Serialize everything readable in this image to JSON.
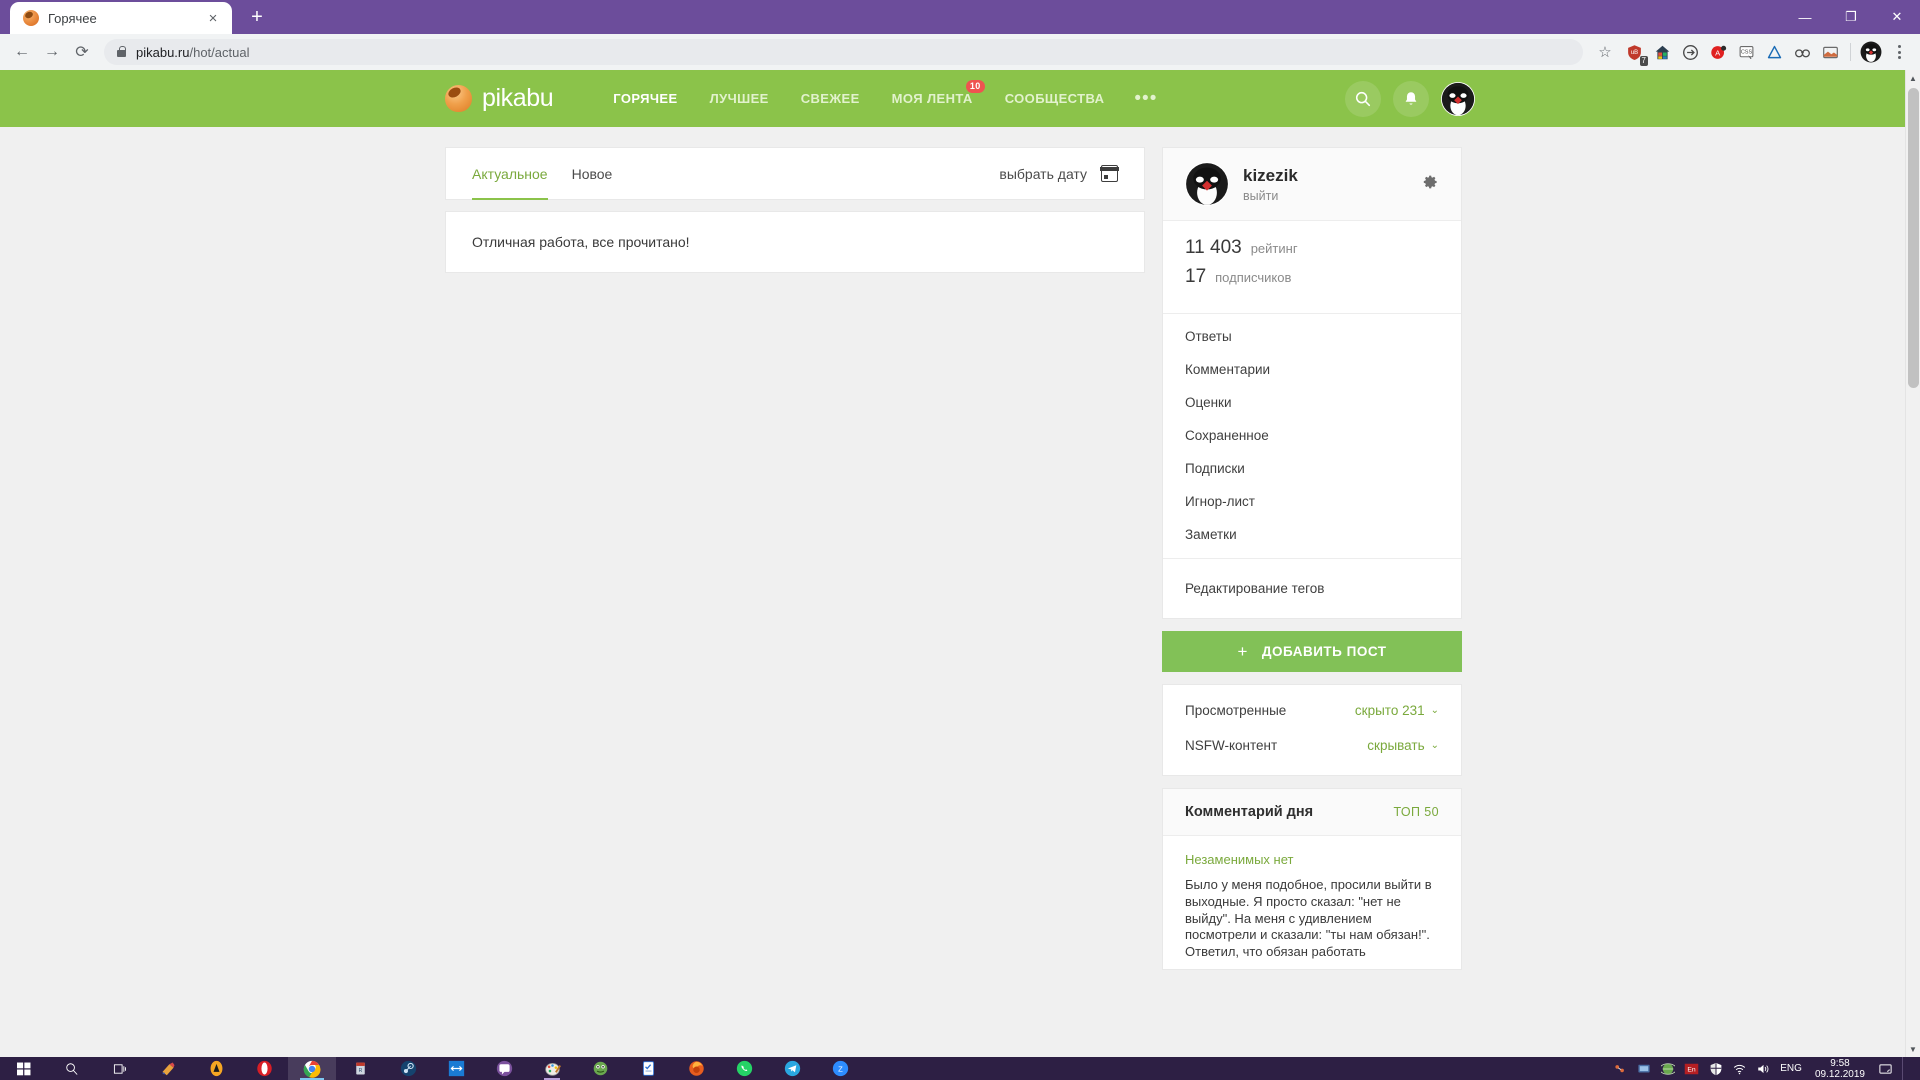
{
  "browser": {
    "tab": {
      "title": "Горячее",
      "favicon": "pikabu-favicon",
      "close": "×"
    },
    "new_tab": "+",
    "window_controls": {
      "minimize": "—",
      "maximize": "❐",
      "close": "✕"
    },
    "nav": {
      "back": "←",
      "forward": "→",
      "reload": "⟳"
    },
    "address": {
      "domain": "pikabu.ru",
      "path": "/hot/actual",
      "lock": "secure-lock"
    },
    "bookmark_star": "☆",
    "extensions": [
      {
        "name": "ublock-origin-icon",
        "badge": "7"
      },
      {
        "name": "colorful-house-icon",
        "badge": ""
      },
      {
        "name": "circle-arrow-icon",
        "badge": ""
      },
      {
        "name": "adblock-icon",
        "badge": ""
      },
      {
        "name": "css-viewer-icon",
        "badge": ""
      },
      {
        "name": "triangle-icon",
        "badge": ""
      },
      {
        "name": "binoculars-icon",
        "badge": ""
      },
      {
        "name": "screenshot-icon",
        "badge": ""
      }
    ],
    "profile_avatar": "penguin-avatar",
    "menu": "⋮"
  },
  "site": {
    "logo_text": "pikabu",
    "nav": [
      {
        "label": "ГОРЯЧЕЕ",
        "active": true,
        "badge": ""
      },
      {
        "label": "ЛУЧШЕЕ",
        "active": false,
        "badge": ""
      },
      {
        "label": "СВЕЖЕЕ",
        "active": false,
        "badge": ""
      },
      {
        "label": "МОЯ ЛЕНТА",
        "active": false,
        "badge": "10"
      },
      {
        "label": "СООБЩЕСТВА",
        "active": false,
        "badge": ""
      }
    ],
    "nav_more": "•••",
    "search_icon": "search-icon",
    "bell_icon": "bell-icon",
    "avatar": "penguin-avatar"
  },
  "main": {
    "tabs": [
      {
        "label": "Актуальное",
        "active": true
      },
      {
        "label": "Новое",
        "active": false
      }
    ],
    "date_picker": {
      "label": "выбрать дату",
      "icon": "calendar-icon"
    },
    "empty_message": "Отличная работа, все прочитано!"
  },
  "sidebar": {
    "user": {
      "name": "kizezik",
      "logout": "выйти",
      "settings_icon": "gear-icon",
      "avatar": "penguin-avatar"
    },
    "stats": [
      {
        "value": "11 403",
        "label": "рейтинг"
      },
      {
        "value": "17",
        "label": "подписчиков"
      }
    ],
    "menu": [
      "Ответы",
      "Комментарии",
      "Оценки",
      "Сохраненное",
      "Подписки",
      "Игнор-лист",
      "Заметки"
    ],
    "menu_tail": "Редактирование тегов",
    "add_post": {
      "plus": "+",
      "label": "ДОБАВИТЬ ПОСТ"
    },
    "prefs": [
      {
        "label": "Просмотренные",
        "value": "скрыто 231",
        "chevron": "⌄"
      },
      {
        "label": "NSFW-контент",
        "value": "скрывать",
        "chevron": "⌄"
      }
    ],
    "comment_of_day": {
      "title": "Комментарий дня",
      "top": "ТОП 50",
      "author": "Незаменимых нет",
      "text": "Было у меня подобное, просили выйти в выходные. Я просто сказал: \"нет не выйду\". На меня с удивлением посмотрели и сказали: \"ты нам обязан!\". Ответил, что обязан работать"
    }
  },
  "taskbar": {
    "start": "start-icon",
    "search": "search-icon",
    "taskview": "task-view-icon",
    "apps": [
      {
        "name": "corel-icon",
        "state": ""
      },
      {
        "name": "avast-icon",
        "state": ""
      },
      {
        "name": "opera-icon",
        "state": ""
      },
      {
        "name": "chrome-icon",
        "state": "active"
      },
      {
        "name": "redshift-icon",
        "state": ""
      },
      {
        "name": "steam-icon",
        "state": ""
      },
      {
        "name": "teamviewer-icon",
        "state": ""
      },
      {
        "name": "viber-icon",
        "state": ""
      },
      {
        "name": "paint-icon",
        "state": "open"
      },
      {
        "name": "frog-app-icon",
        "state": ""
      },
      {
        "name": "todo-app-icon",
        "state": ""
      },
      {
        "name": "firefox-icon",
        "state": ""
      },
      {
        "name": "whatsapp-icon",
        "state": ""
      },
      {
        "name": "telegram-icon",
        "state": ""
      },
      {
        "name": "zoom-icon",
        "state": ""
      }
    ],
    "tray": [
      {
        "name": "hardware-icon"
      },
      {
        "name": "display-icon"
      },
      {
        "name": "globe-icon"
      },
      {
        "name": "language-box-icon",
        "label": "En"
      },
      {
        "name": "defender-shield-icon"
      },
      {
        "name": "wifi-icon"
      },
      {
        "name": "volume-icon"
      }
    ],
    "language": "ENG",
    "time": "9:58",
    "date": "09.12.2019",
    "action_center": "notification-icon"
  },
  "colors": {
    "brand_green": "#8bc34a",
    "browser_frame": "#6c4d9b",
    "accent_green": "#7aa93c",
    "badge_red": "#ef5350"
  }
}
